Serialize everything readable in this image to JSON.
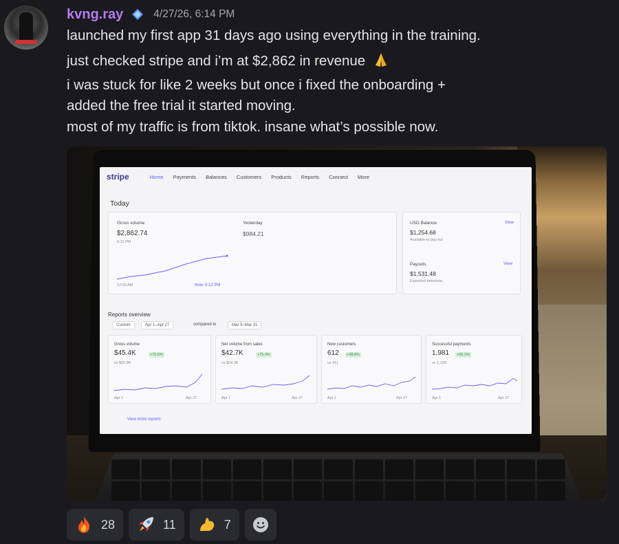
{
  "message": {
    "username": "kvng.ray",
    "badge_icon": "diamond-badge-icon",
    "timestamp": "4/27/26, 6:14 PM",
    "lines": [
      "launched my first app 31 days ago using everything in the training.",
      "just checked stripe and i’m at $2,862 in revenue",
      "i was stuck for like 2 weeks but once i fixed the onboarding +",
      "added the free trial it started moving.",
      "most of my traffic is from tiktok. insane what’s possible now."
    ],
    "inline_emoji": "folded-hands-icon"
  },
  "stripe": {
    "logo": "stripe",
    "nav": [
      "Home",
      "Payments",
      "Balances",
      "Customers",
      "Products",
      "Reports",
      "Connect",
      "More"
    ],
    "today_title": "Today",
    "gross_volume_label": "Gross volume",
    "gross_volume_value": "$2,862.74",
    "gross_volume_time": "6:12 PM",
    "yesterday_label": "Yesterday",
    "yesterday_value": "$984.21",
    "axis_start": "12:00 AM",
    "axis_end": "Now, 6:12 PM",
    "usd_balance_label": "USD Balance",
    "usd_balance_value": "$1,254.68",
    "usd_balance_sub": "Available to pay out",
    "payouts_label": "Payouts",
    "payouts_value": "$1,531.48",
    "payouts_sub": "Expected tomorrow",
    "view_label": "View",
    "reports_title": "Reports overview",
    "custom_label": "Custom",
    "date_range": "Apr 1–Apr 27",
    "compared_to": "compared to",
    "compare_range": "Mar 5–Mar 31",
    "metrics": [
      {
        "label": "Gross volume",
        "value": "$45.4K",
        "change": "+75.6%",
        "vs": "vs $25.8K"
      },
      {
        "label": "Net volume from sales",
        "value": "$42.7K",
        "change": "+75.4%",
        "vs": "vs $24.3K"
      },
      {
        "label": "New customers",
        "value": "612",
        "change": "+48.8%",
        "vs": "vs 411"
      },
      {
        "label": "Successful payments",
        "value": "1,981",
        "change": "+65.1%",
        "vs": "vs 1,199"
      }
    ],
    "mini_axis_start": "Apr 1",
    "mini_axis_end": "Apr 27",
    "view_more": "View more reports"
  },
  "reactions": [
    {
      "icon": "fire-icon",
      "count": "28"
    },
    {
      "icon": "rocket-icon",
      "count": "11"
    },
    {
      "icon": "flexed-biceps-icon",
      "count": "7"
    }
  ],
  "add_reaction_icon": "smiley-add-reaction-icon"
}
